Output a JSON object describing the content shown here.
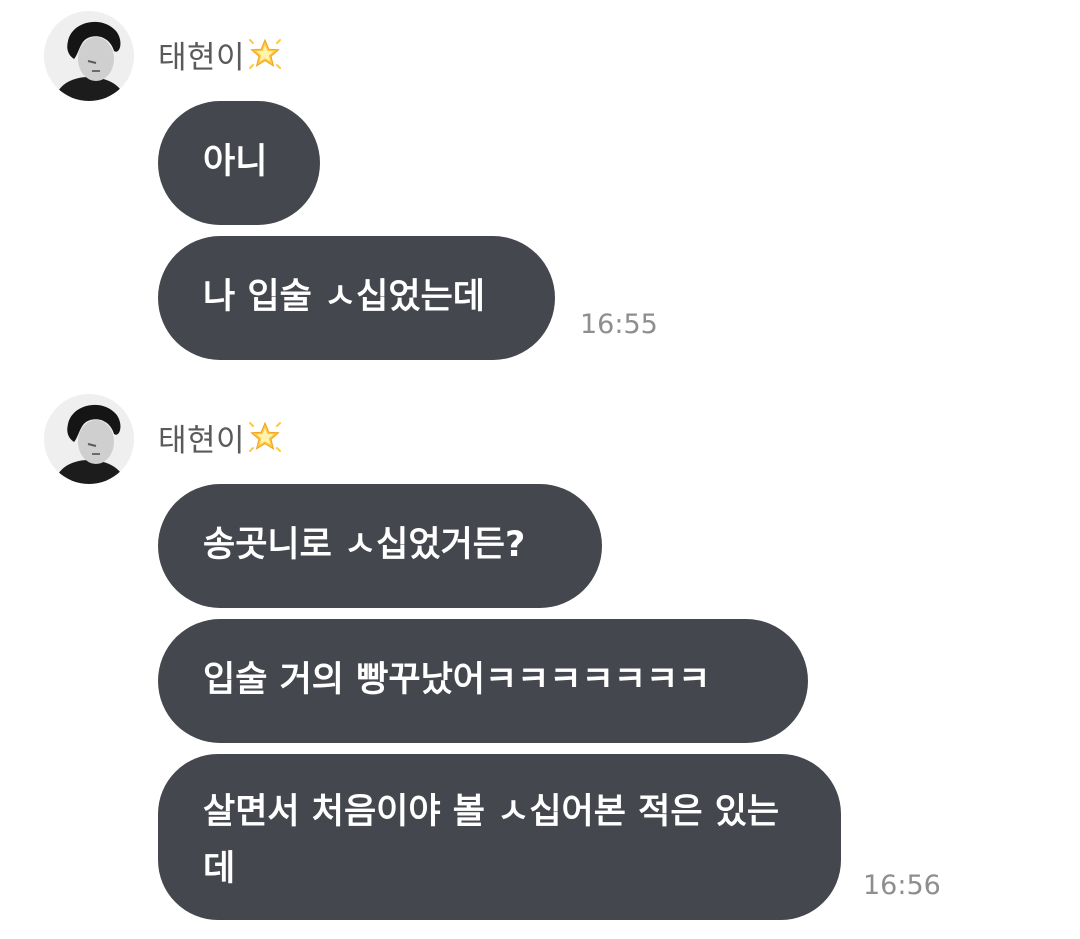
{
  "groups": [
    {
      "sender": "태현이",
      "sender_emoji": "glowing-star-icon",
      "messages": [
        {
          "text": "아니"
        },
        {
          "text": "나 입술 ㅅ십었는데"
        }
      ],
      "time": "16:55"
    },
    {
      "sender": "태현이",
      "sender_emoji": "glowing-star-icon",
      "messages": [
        {
          "text": "송곳니로 ㅅ십었거든?"
        },
        {
          "text": "입술 거의 빵꾸났어ㅋㅋㅋㅋㅋㅋㅋ"
        },
        {
          "text": "살면서 처음이야 볼 ㅅ십어본 적은 있는데"
        }
      ],
      "time": "16:56"
    }
  ],
  "colors": {
    "bubble": "#45474e",
    "bubble_text": "#ffffff",
    "sender_text": "#5a5a5a",
    "time_text": "#8e8e8e",
    "background": "#ffffff"
  }
}
